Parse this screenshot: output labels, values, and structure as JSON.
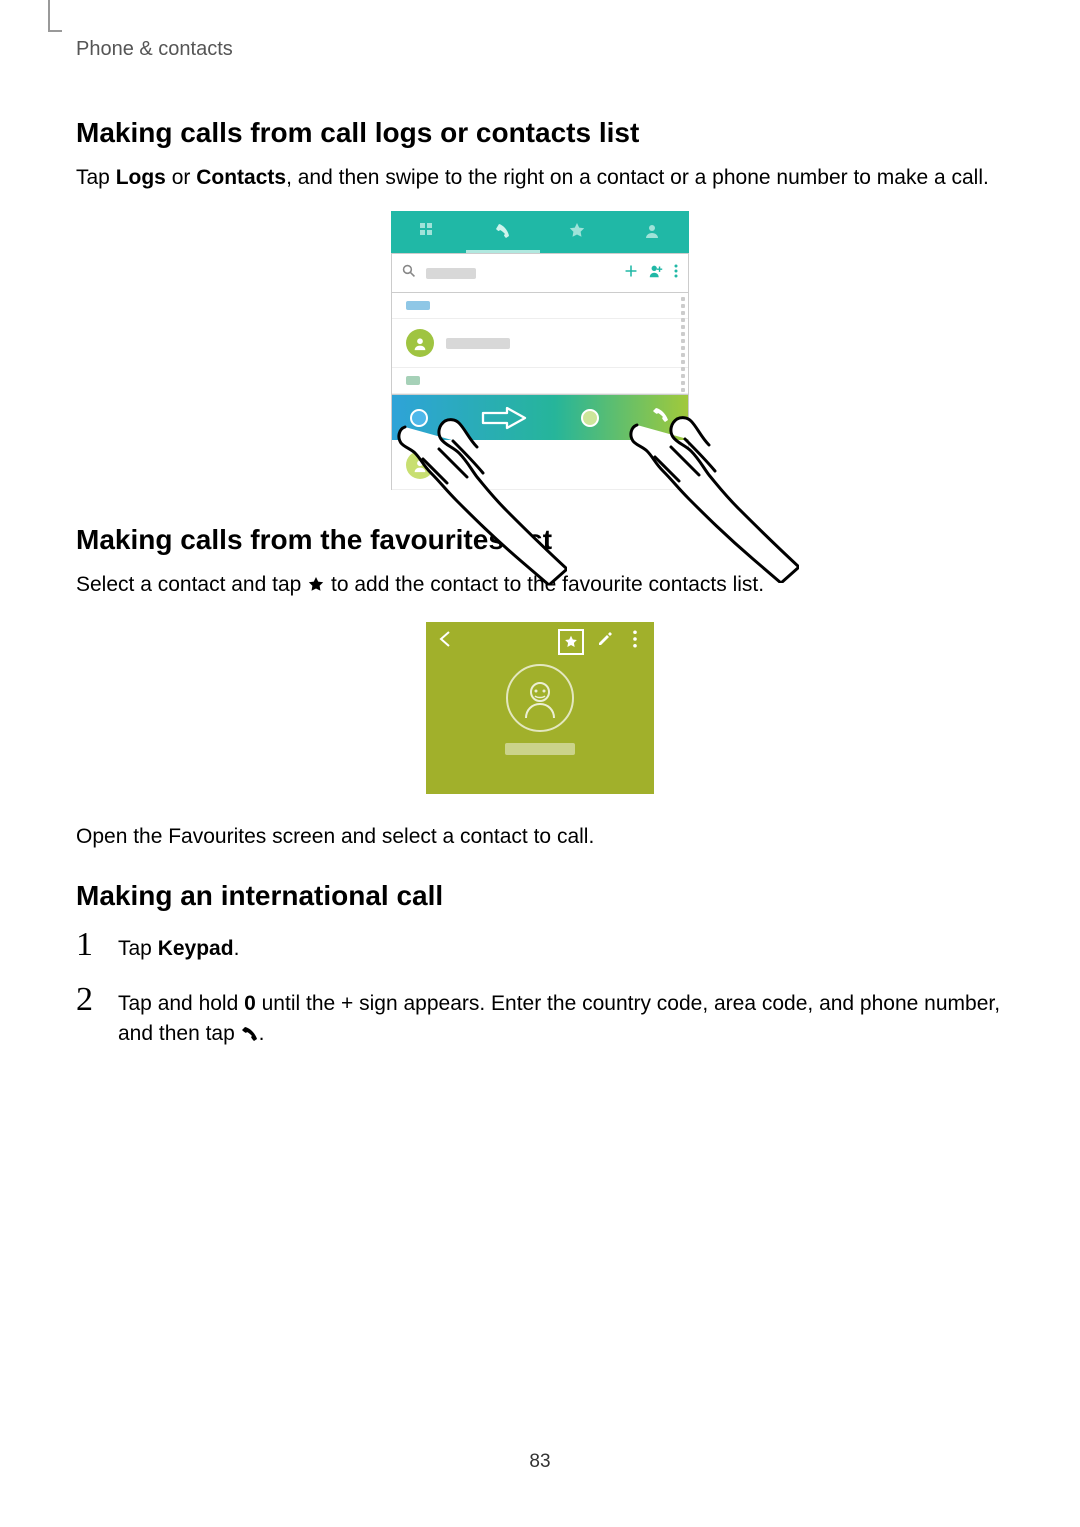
{
  "breadcrumb": "Phone & contacts",
  "section1": {
    "heading": "Making calls from call logs or contacts list",
    "body_pre": "Tap ",
    "logs": "Logs",
    "or": " or ",
    "contacts": "Contacts",
    "body_post": ", and then swipe to the right on a contact or a phone number to make a call."
  },
  "section2": {
    "heading": "Making calls from the favourites list",
    "body_pre": "Select a contact and tap ",
    "body_post": " to add the contact to the favourite contacts list.",
    "body2": "Open the Favourites screen and select a contact to call."
  },
  "section3": {
    "heading": "Making an international call",
    "step1_num": "1",
    "step1_pre": "Tap ",
    "step1_bold": "Keypad",
    "step1_post": ".",
    "step2_num": "2",
    "step2_pre": "Tap and hold ",
    "step2_bold": "0",
    "step2_mid": " until the + sign appears. Enter the country code, area code, and phone number, and then tap ",
    "step2_post": "."
  },
  "page_number": "83",
  "icons": {
    "star": "star-icon",
    "phone": "phone-icon"
  }
}
